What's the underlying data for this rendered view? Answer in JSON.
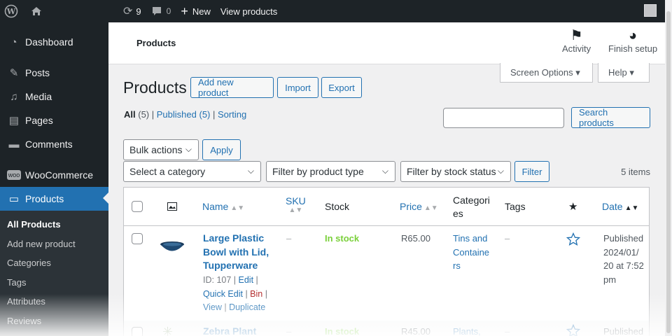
{
  "admin_bar": {
    "wp_logo_icon": "wordpress-icon",
    "home_icon": "home-icon",
    "updates_count": "9",
    "comments_count": "0",
    "new_label": "New",
    "view_products_label": "View products"
  },
  "sidebar": {
    "items": [
      {
        "label": "Dashboard",
        "icon": "dashboard-icon"
      },
      {
        "label": "Posts",
        "icon": "pin-icon"
      },
      {
        "label": "Media",
        "icon": "media-icon"
      },
      {
        "label": "Pages",
        "icon": "page-icon"
      },
      {
        "label": "Comments",
        "icon": "comment-icon"
      },
      {
        "label": "WooCommerce",
        "icon": "woocommerce-icon"
      },
      {
        "label": "Products",
        "icon": "archive-icon"
      }
    ],
    "submenu": [
      "All Products",
      "Add new product",
      "Categories",
      "Tags",
      "Attributes",
      "Reviews"
    ]
  },
  "header": {
    "title": "Products",
    "activity_label": "Activity",
    "finish_setup_label": "Finish setup",
    "screen_options_label": "Screen Options ▾",
    "help_label": "Help ▾"
  },
  "page": {
    "title": "Products",
    "add_new_label": "Add new product",
    "import_label": "Import",
    "export_label": "Export",
    "filters": {
      "all": "All",
      "all_count": "(5)",
      "published": "Published",
      "published_count": "(5)",
      "sorting": "Sorting"
    },
    "search_button": "Search products",
    "bulk_actions": "Bulk actions",
    "apply_label": "Apply",
    "category_select": "Select a category",
    "product_type_select": "Filter by product type",
    "stock_status_select": "Filter by stock status",
    "filter_button": "Filter",
    "items_count": "5 items"
  },
  "table": {
    "columns": {
      "name": "Name",
      "sku": "SKU",
      "stock": "Stock",
      "price": "Price",
      "categories_line1": "Categori",
      "categories_line2": "es",
      "tags": "Tags",
      "date": "Date"
    },
    "rows": [
      {
        "name_lines": [
          "Large Plastic",
          "Bowl with Lid,",
          "Tupperware"
        ],
        "id_text": "ID: 107 |",
        "edit": "Edit",
        "quick_edit": "Quick Edit",
        "bin": "Bin",
        "view": "View",
        "duplicate": "Duplicate",
        "sku": "–",
        "stock": "In stock",
        "price": "R65.00",
        "category_lines": [
          "Tins and",
          "Containe",
          "rs"
        ],
        "tags": "–",
        "date_lines": [
          "Published",
          "2024/01/",
          "20 at 7:52",
          "pm"
        ]
      },
      {
        "name_lines": [
          "Zebra Plant"
        ],
        "sku": "–",
        "stock": "In stock",
        "price": "R45.00",
        "category_lines": [
          "Plants,"
        ],
        "tags": "–",
        "date_lines": [
          "Published"
        ]
      }
    ]
  },
  "colors": {
    "admin_dark": "#1d2327",
    "accent_blue": "#2271b1",
    "in_stock_green": "#7ad03a",
    "bin_red": "#b32d2e"
  }
}
